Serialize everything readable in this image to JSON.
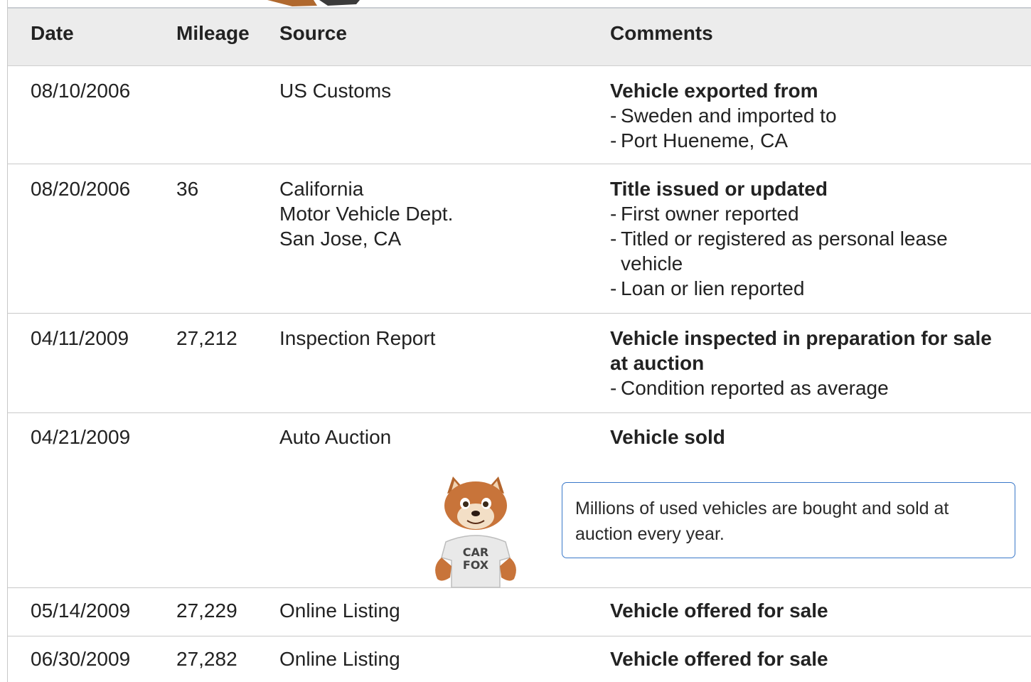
{
  "table": {
    "headers": {
      "date": "Date",
      "mileage": "Mileage",
      "source": "Source",
      "comments": "Comments"
    },
    "rows": [
      {
        "date": "08/10/2006",
        "mileage": "",
        "source": [
          "US Customs"
        ],
        "comment_title": "Vehicle exported from",
        "comment_lines": [
          "Sweden and imported to",
          "Port Hueneme, CA"
        ]
      },
      {
        "date": "08/20/2006",
        "mileage": "36",
        "source": [
          "California",
          "Motor Vehicle Dept.",
          "San Jose, CA"
        ],
        "comment_title": "Title issued or updated",
        "comment_lines": [
          "First owner reported",
          "Titled or registered as personal lease vehicle",
          "Loan or lien reported"
        ]
      },
      {
        "date": "04/11/2009",
        "mileage": "27,212",
        "source": [
          "Inspection Report"
        ],
        "comment_title": "Vehicle inspected in preparation for sale at auction",
        "comment_lines": [
          "Condition reported as average"
        ]
      },
      {
        "date": "04/21/2009",
        "mileage": "",
        "source": [
          "Auto Auction"
        ],
        "comment_title": "Vehicle sold",
        "comment_lines": []
      },
      {
        "date": "05/14/2009",
        "mileage": "27,229",
        "source": [
          "Online Listing"
        ],
        "comment_title": "Vehicle offered for sale",
        "comment_lines": []
      },
      {
        "date": "06/30/2009",
        "mileage": "27,282",
        "source": [
          "Online Listing"
        ],
        "comment_title": "Vehicle offered for sale",
        "comment_lines": []
      }
    ]
  },
  "auction_tip": {
    "text": "Millions of used vehicles are bought and sold at auction every year.",
    "mascot_shirt": "CAR FOX",
    "mascot_icon": "carfox-mascot-icon"
  },
  "colors": {
    "header_bg": "#ececec",
    "tip_border": "#3a78c9",
    "fox_orange": "#c8743a"
  }
}
